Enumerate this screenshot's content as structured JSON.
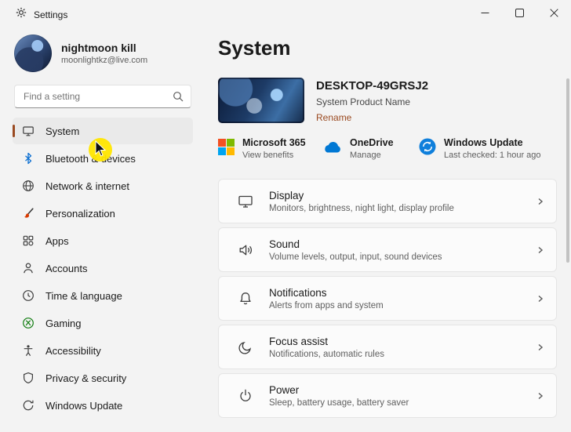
{
  "colors": {
    "accent": "#9a4a21",
    "bluetooth_blue": "#0a6ed1",
    "gaming_green": "#107c10",
    "brush_red": "#d83b01",
    "ms_red": "#f25022",
    "ms_green": "#7fba00",
    "ms_blue": "#00a4ef",
    "ms_yellow": "#ffb900",
    "onedrive_blue": "#0078d4",
    "update_blue": "#0f7fdb",
    "cursor_highlight": "#ffe600"
  },
  "titlebar": {
    "title": "Settings"
  },
  "sidebar": {
    "user": {
      "name": "nightmoon kill",
      "email": "moonlightkz@live.com"
    },
    "search": {
      "placeholder": "Find a setting"
    },
    "items": [
      {
        "label": "System",
        "selected": true
      },
      {
        "label": "Bluetooth & devices"
      },
      {
        "label": "Network & internet"
      },
      {
        "label": "Personalization"
      },
      {
        "label": "Apps"
      },
      {
        "label": "Accounts"
      },
      {
        "label": "Time & language"
      },
      {
        "label": "Gaming"
      },
      {
        "label": "Accessibility"
      },
      {
        "label": "Privacy & security"
      },
      {
        "label": "Windows Update"
      }
    ]
  },
  "main": {
    "title": "System",
    "device": {
      "name": "DESKTOP-49GRSJ2",
      "product": "System Product Name",
      "rename_label": "Rename"
    },
    "quick_links": [
      {
        "title": "Microsoft 365",
        "subtitle": "View benefits"
      },
      {
        "title": "OneDrive",
        "subtitle": "Manage"
      },
      {
        "title": "Windows Update",
        "subtitle": "Last checked: 1 hour ago"
      }
    ],
    "cards": [
      {
        "title": "Display",
        "subtitle": "Monitors, brightness, night light, display profile"
      },
      {
        "title": "Sound",
        "subtitle": "Volume levels, output, input, sound devices"
      },
      {
        "title": "Notifications",
        "subtitle": "Alerts from apps and system"
      },
      {
        "title": "Focus assist",
        "subtitle": "Notifications, automatic rules"
      },
      {
        "title": "Power",
        "subtitle": "Sleep, battery usage, battery saver"
      }
    ]
  }
}
